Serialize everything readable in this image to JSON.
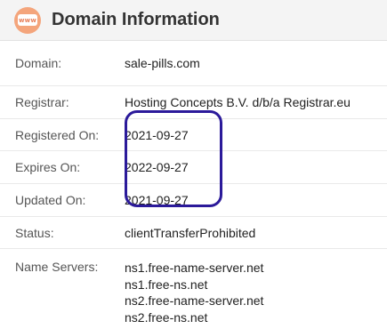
{
  "header": {
    "icon": "www-icon",
    "icon_text": "www",
    "title": "Domain Information",
    "accent_color": "#f4a57c"
  },
  "rows": {
    "domain": {
      "label": "Domain:",
      "value": "sale-pills.com"
    },
    "registrar": {
      "label": "Registrar:",
      "value": "Hosting Concepts B.V. d/b/a Registrar.eu"
    },
    "registered_on": {
      "label": "Registered On:",
      "value": "2021-09-27"
    },
    "expires_on": {
      "label": "Expires On:",
      "value": "2022-09-27"
    },
    "updated_on": {
      "label": "Updated On:",
      "value": "2021-09-27"
    },
    "status": {
      "label": "Status:",
      "value": "clientTransferProhibited"
    },
    "name_servers": {
      "label": "Name Servers:",
      "values": [
        "ns1.free-name-server.net",
        "ns1.free-ns.net",
        "ns2.free-name-server.net",
        "ns2.free-ns.net"
      ]
    }
  },
  "annotation": {
    "color": "#2b1a9a"
  }
}
